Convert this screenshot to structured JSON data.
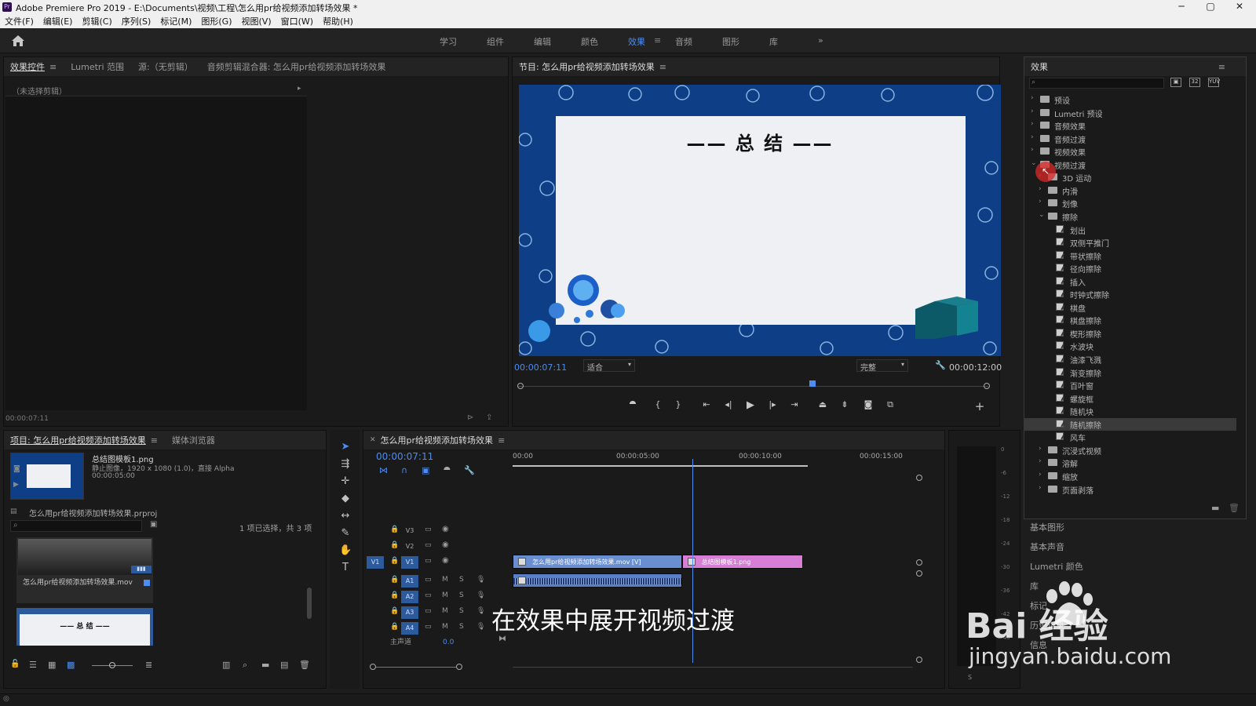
{
  "window": {
    "title": "Adobe Premiere Pro 2019 - E:\\Documents\\视频\\工程\\怎么用pr给视频添加转场效果 *",
    "icon": "premiere-pro-icon",
    "minimize": "─",
    "maximize": "▢",
    "close": "✕"
  },
  "menu": [
    "文件(F)",
    "编辑(E)",
    "剪辑(C)",
    "序列(S)",
    "标记(M)",
    "图形(G)",
    "视图(V)",
    "窗口(W)",
    "帮助(H)"
  ],
  "workspaces": {
    "items": [
      "学习",
      "组件",
      "编辑",
      "颜色",
      "效果",
      "音频",
      "图形",
      "库"
    ],
    "active": "效果",
    "more": "»"
  },
  "source_panel": {
    "tabs": [
      "效果控件",
      "Lumetri 范围",
      "源:（无剪辑）",
      "音频剪辑混合器: 怎么用pr给视频添加转场效果"
    ],
    "no_clip": "（未选择剪辑）",
    "timecode": "00:00:07:11"
  },
  "program_monitor": {
    "title": "节目: 怎么用pr给视频添加转场效果",
    "slide_title": "—— 总 结 ——",
    "timecode": "00:00:07:11",
    "fit": "适合",
    "quality": "完整",
    "duration": "00:00:12:00",
    "playhead_fraction": 0.62,
    "controls": [
      "marker",
      "in-point",
      "out-point",
      "go-to-in",
      "step-back",
      "play",
      "step-forward",
      "go-to-out",
      "lift",
      "extract",
      "export-frame",
      "compare"
    ]
  },
  "effects_panel": {
    "title": "效果",
    "tree": [
      {
        "label": "预设",
        "level": 0,
        "kind": "folder",
        "expanded": false
      },
      {
        "label": "Lumetri 预设",
        "level": 0,
        "kind": "folder",
        "expanded": false
      },
      {
        "label": "音频效果",
        "level": 0,
        "kind": "folder",
        "expanded": false
      },
      {
        "label": "音频过渡",
        "level": 0,
        "kind": "folder",
        "expanded": false
      },
      {
        "label": "视频效果",
        "level": 0,
        "kind": "folder",
        "expanded": false
      },
      {
        "label": "视频过渡",
        "level": 0,
        "kind": "folder",
        "expanded": true
      },
      {
        "label": "3D 运动",
        "level": 1,
        "kind": "folder",
        "expanded": false
      },
      {
        "label": "内滑",
        "level": 1,
        "kind": "folder",
        "expanded": false
      },
      {
        "label": "划像",
        "level": 1,
        "kind": "folder",
        "expanded": false
      },
      {
        "label": "擦除",
        "level": 1,
        "kind": "folder",
        "expanded": true
      },
      {
        "label": "划出",
        "level": 2,
        "kind": "effect"
      },
      {
        "label": "双侧平推门",
        "level": 2,
        "kind": "effect"
      },
      {
        "label": "带状擦除",
        "level": 2,
        "kind": "effect"
      },
      {
        "label": "径向擦除",
        "level": 2,
        "kind": "effect"
      },
      {
        "label": "插入",
        "level": 2,
        "kind": "effect"
      },
      {
        "label": "时钟式擦除",
        "level": 2,
        "kind": "effect"
      },
      {
        "label": "棋盘",
        "level": 2,
        "kind": "effect"
      },
      {
        "label": "棋盘擦除",
        "level": 2,
        "kind": "effect"
      },
      {
        "label": "楔形擦除",
        "level": 2,
        "kind": "effect"
      },
      {
        "label": "水波块",
        "level": 2,
        "kind": "effect"
      },
      {
        "label": "油漆飞溅",
        "level": 2,
        "kind": "effect"
      },
      {
        "label": "渐变擦除",
        "level": 2,
        "kind": "effect"
      },
      {
        "label": "百叶窗",
        "level": 2,
        "kind": "effect"
      },
      {
        "label": "螺旋框",
        "level": 2,
        "kind": "effect"
      },
      {
        "label": "随机块",
        "level": 2,
        "kind": "effect"
      },
      {
        "label": "随机擦除",
        "level": 2,
        "kind": "effect",
        "selected": true
      },
      {
        "label": "风车",
        "level": 2,
        "kind": "effect"
      },
      {
        "label": "沉浸式视频",
        "level": 1,
        "kind": "folder",
        "expanded": false
      },
      {
        "label": "溶解",
        "level": 1,
        "kind": "folder",
        "expanded": false
      },
      {
        "label": "缩放",
        "level": 1,
        "kind": "folder",
        "expanded": false
      },
      {
        "label": "页面剥落",
        "level": 1,
        "kind": "folder",
        "expanded": false
      }
    ],
    "collapsed_panels": [
      "基本图形",
      "基本声音",
      "Lumetri 颜色",
      "库",
      "标记",
      "历史记录",
      "信息"
    ]
  },
  "project_panel": {
    "tabs": [
      "项目: 怎么用pr给视频添加转场效果",
      "媒体浏览器"
    ],
    "preview": {
      "name": "总结图模板1.png",
      "info1": "静止图像，1920 x 1080 (1.0)，直接 Alpha",
      "info2": "00:00:05:00"
    },
    "project_file": "怎么用pr给视频添加转场效果.prproj",
    "selection": "1 项已选择，共 3 项",
    "items": [
      {
        "name": "怎么用pr给视频添加转场效果.mov"
      },
      {
        "name": "总结图模板1.png"
      }
    ],
    "thumb_text": "—— 总 结 ——"
  },
  "timeline": {
    "title": "怎么用pr给视频添加转场效果",
    "timecode": "00:00:07:11",
    "ruler": [
      "00:00",
      "00:00:05:00",
      "00:00:10:00",
      "00:00:15:00"
    ],
    "video_tracks": [
      "V3",
      "V2",
      "V1"
    ],
    "audio_tracks": [
      "A1",
      "A2",
      "A3",
      "A4"
    ],
    "master": "主声道",
    "master_value": "0.0",
    "source_patch": "V1",
    "clips": [
      {
        "label": "怎么用pr给视频添加转场效果.mov [V]",
        "track": "V1",
        "color": "#6a8fd0",
        "start": 0,
        "end": 7
      },
      {
        "label": "总结图模板1.png",
        "track": "V1",
        "color": "#d77fd7",
        "start": 7,
        "end": 12
      },
      {
        "label": "",
        "track": "A1",
        "color": "#5a7fc6",
        "start": 0,
        "end": 7
      }
    ]
  },
  "audio_meter": {
    "scale": [
      "0",
      "-6",
      "-12",
      "-18",
      "-24",
      "-30",
      "-36",
      "-42",
      "-48"
    ],
    "solo": "S"
  },
  "subtitle": "在效果中展开视频过渡",
  "watermark": {
    "brand": "Bai 经验",
    "url": "jingyan.baidu.com"
  },
  "colors": {
    "accent": "#4d8cf0",
    "slide_bg": "#0d3e86",
    "clip_video": "#6a8fd0",
    "clip_image": "#d77fd7",
    "selected_row": "#3a3a3a"
  }
}
